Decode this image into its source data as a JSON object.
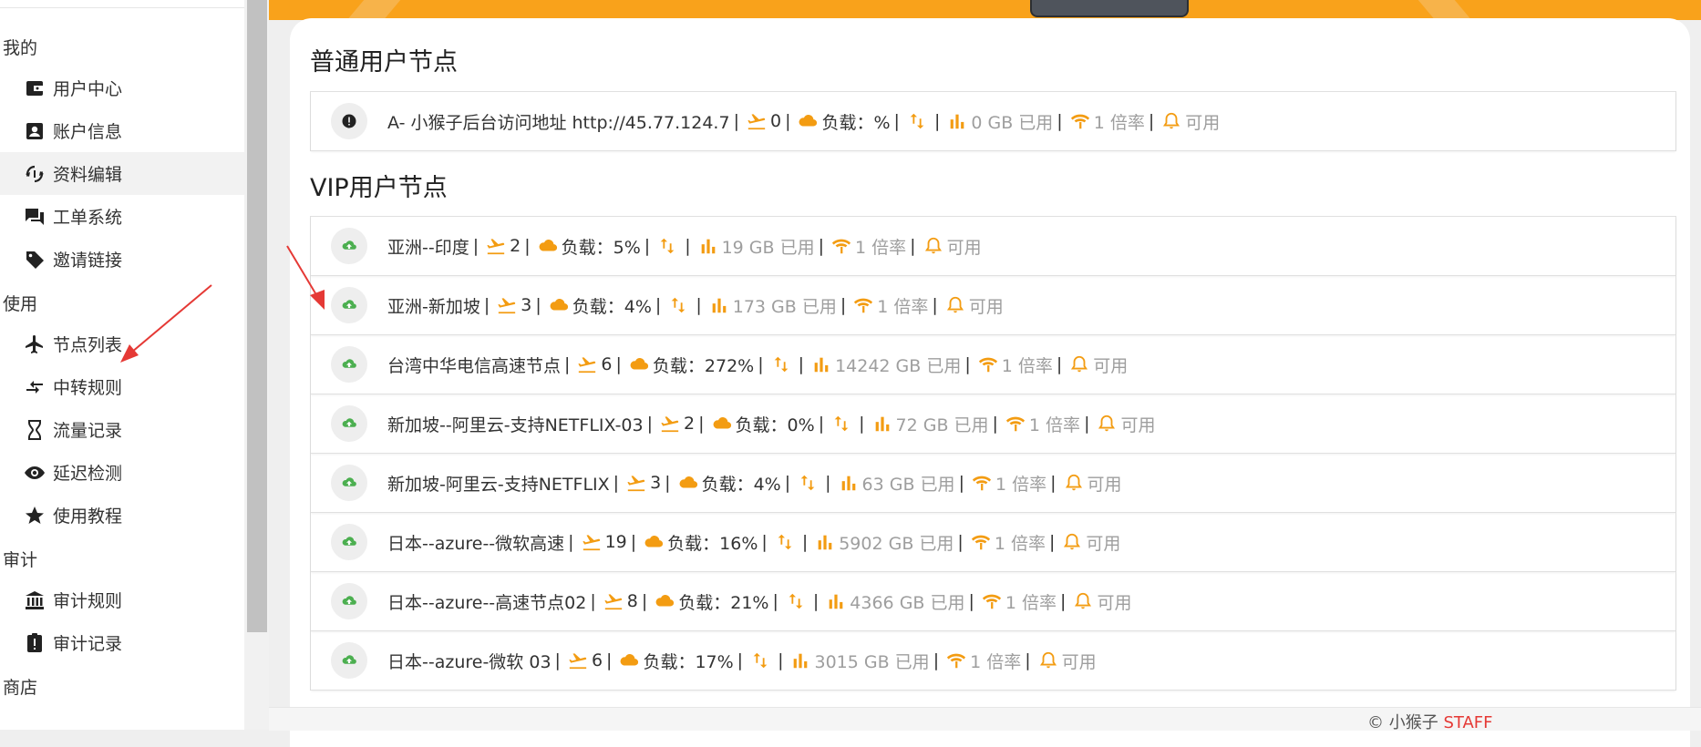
{
  "sidebar": {
    "sections": [
      {
        "title": "我的",
        "items": [
          {
            "label": "用户中心",
            "icon": "wallet-icon"
          },
          {
            "label": "账户信息",
            "icon": "account-box-icon"
          },
          {
            "label": "资料编辑",
            "icon": "sync-edit-icon",
            "active": true
          },
          {
            "label": "工单系统",
            "icon": "forum-icon"
          },
          {
            "label": "邀请链接",
            "icon": "tag-icon"
          }
        ]
      },
      {
        "title": "使用",
        "items": [
          {
            "label": "节点列表",
            "icon": "airplane-icon"
          },
          {
            "label": "中转规则",
            "icon": "transfer-icon"
          },
          {
            "label": "流量记录",
            "icon": "hourglass-icon"
          },
          {
            "label": "延迟检测",
            "icon": "eye-icon"
          },
          {
            "label": "使用教程",
            "icon": "star-icon"
          }
        ]
      },
      {
        "title": "审计",
        "items": [
          {
            "label": "审计规则",
            "icon": "bank-icon"
          },
          {
            "label": "审计记录",
            "icon": "clipboard-alert-icon"
          }
        ]
      },
      {
        "title": "商店",
        "items": []
      }
    ]
  },
  "colors": {
    "accent": "#f9a21b",
    "icon_orange": "#f39c12",
    "online_green": "#4caf50",
    "text_gray": "#9e9e9e"
  },
  "sections": [
    {
      "title": "普通用户节点",
      "nodes": [
        {
          "status": "info-icon",
          "name": "A- 小猴子后台访问地址 http://45.77.124.7",
          "users": "0",
          "load": "负载：%",
          "traffic": "0 GB 已用",
          "rate": "1 倍率",
          "state": "可用"
        }
      ]
    },
    {
      "title": "VIP用户节点",
      "nodes": [
        {
          "status": "cloud-upload-icon",
          "name": "亚洲--印度",
          "users": "2",
          "load": "负载：5%",
          "traffic": "19 GB 已用",
          "rate": "1 倍率",
          "state": "可用"
        },
        {
          "status": "cloud-upload-icon",
          "name": "亚洲-新加坡",
          "users": "3",
          "load": "负载：4%",
          "traffic": "173 GB 已用",
          "rate": "1 倍率",
          "state": "可用"
        },
        {
          "status": "cloud-upload-icon",
          "name": "台湾中华电信高速节点",
          "users": "6",
          "load": "负载：272%",
          "traffic": "14242 GB 已用",
          "rate": "1 倍率",
          "state": "可用"
        },
        {
          "status": "cloud-upload-icon",
          "name": "新加坡--阿里云-支持NETFLIX-03",
          "users": "2",
          "load": "负载：0%",
          "traffic": "72 GB 已用",
          "rate": "1 倍率",
          "state": "可用"
        },
        {
          "status": "cloud-upload-icon",
          "name": "新加坡-阿里云-支持NETFLIX",
          "users": "3",
          "load": "负载：4%",
          "traffic": "63 GB 已用",
          "rate": "1 倍率",
          "state": "可用"
        },
        {
          "status": "cloud-upload-icon",
          "name": "日本--azure--微软高速",
          "users": "19",
          "load": "负载：16%",
          "traffic": "5902 GB 已用",
          "rate": "1 倍率",
          "state": "可用"
        },
        {
          "status": "cloud-upload-icon",
          "name": "日本--azure--高速节点02",
          "users": "8",
          "load": "负载：21%",
          "traffic": "4366 GB 已用",
          "rate": "1 倍率",
          "state": "可用"
        },
        {
          "status": "cloud-upload-icon",
          "name": "日本--azure-微软 03",
          "users": "6",
          "load": "负载：17%",
          "traffic": "3015 GB 已用",
          "rate": "1 倍率",
          "state": "可用"
        }
      ]
    }
  ],
  "footer": {
    "prefix": "© 小猴子",
    "brand": "STAFF"
  }
}
